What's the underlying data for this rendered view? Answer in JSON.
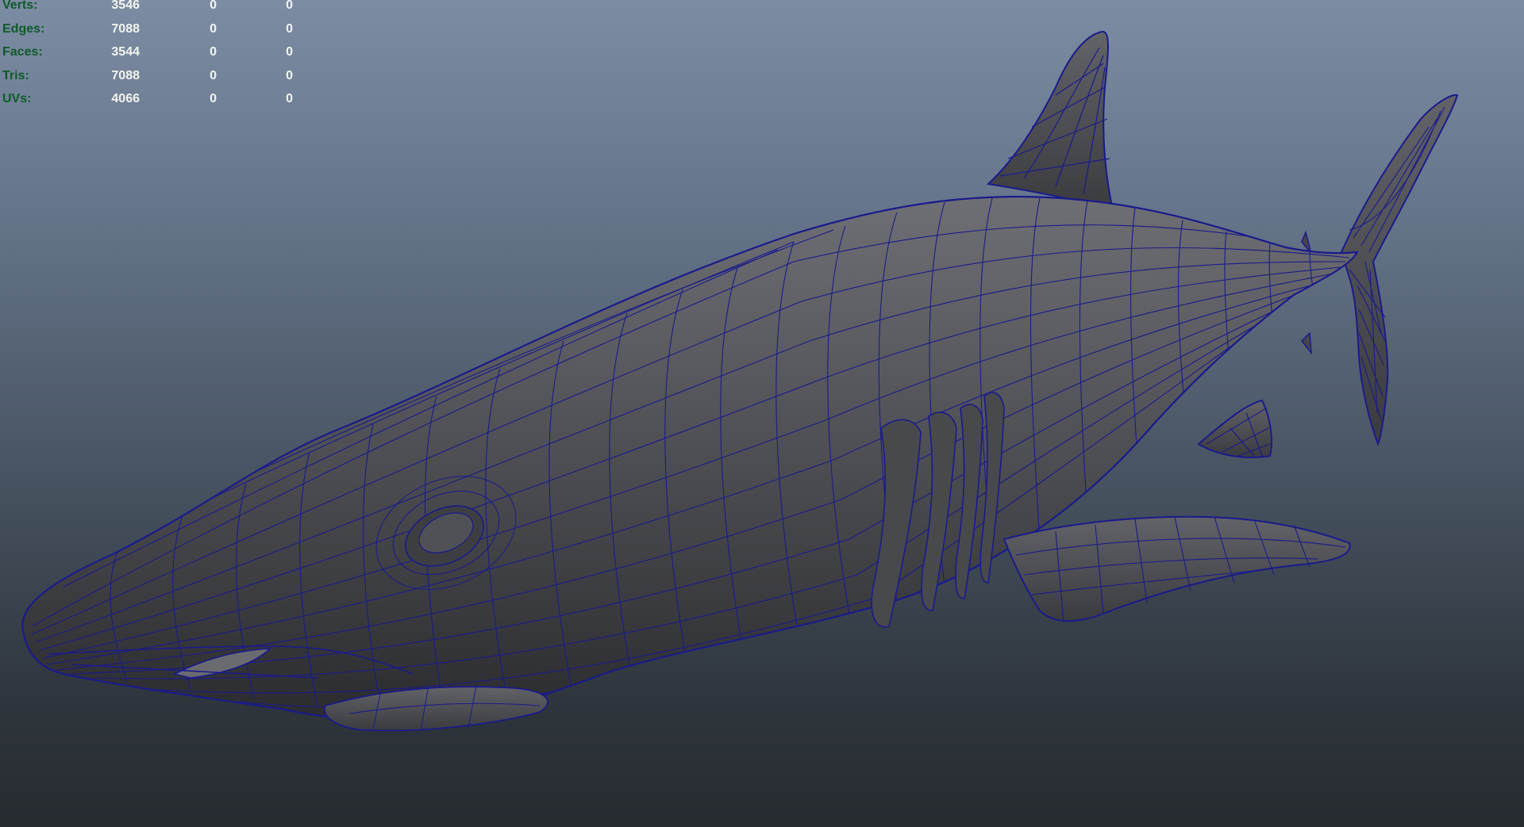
{
  "hud": {
    "rows": [
      {
        "label": "Verts:",
        "value": "3546",
        "col2": "0",
        "col3": "0"
      },
      {
        "label": "Edges:",
        "value": "7088",
        "col2": "0",
        "col3": "0"
      },
      {
        "label": "Faces:",
        "value": "3544",
        "col2": "0",
        "col3": "0"
      },
      {
        "label": "Tris:",
        "value": "7088",
        "col2": "0",
        "col3": "0"
      },
      {
        "label": "UVs:",
        "value": "4066",
        "col2": "0",
        "col3": "0"
      }
    ]
  },
  "viewport": {
    "background_top": "#7c8ca3",
    "background_bottom": "#262b30",
    "model_fill": "#4e4f53",
    "wireframe_color": "#1a1a8c",
    "model_icon": "shark-model"
  }
}
